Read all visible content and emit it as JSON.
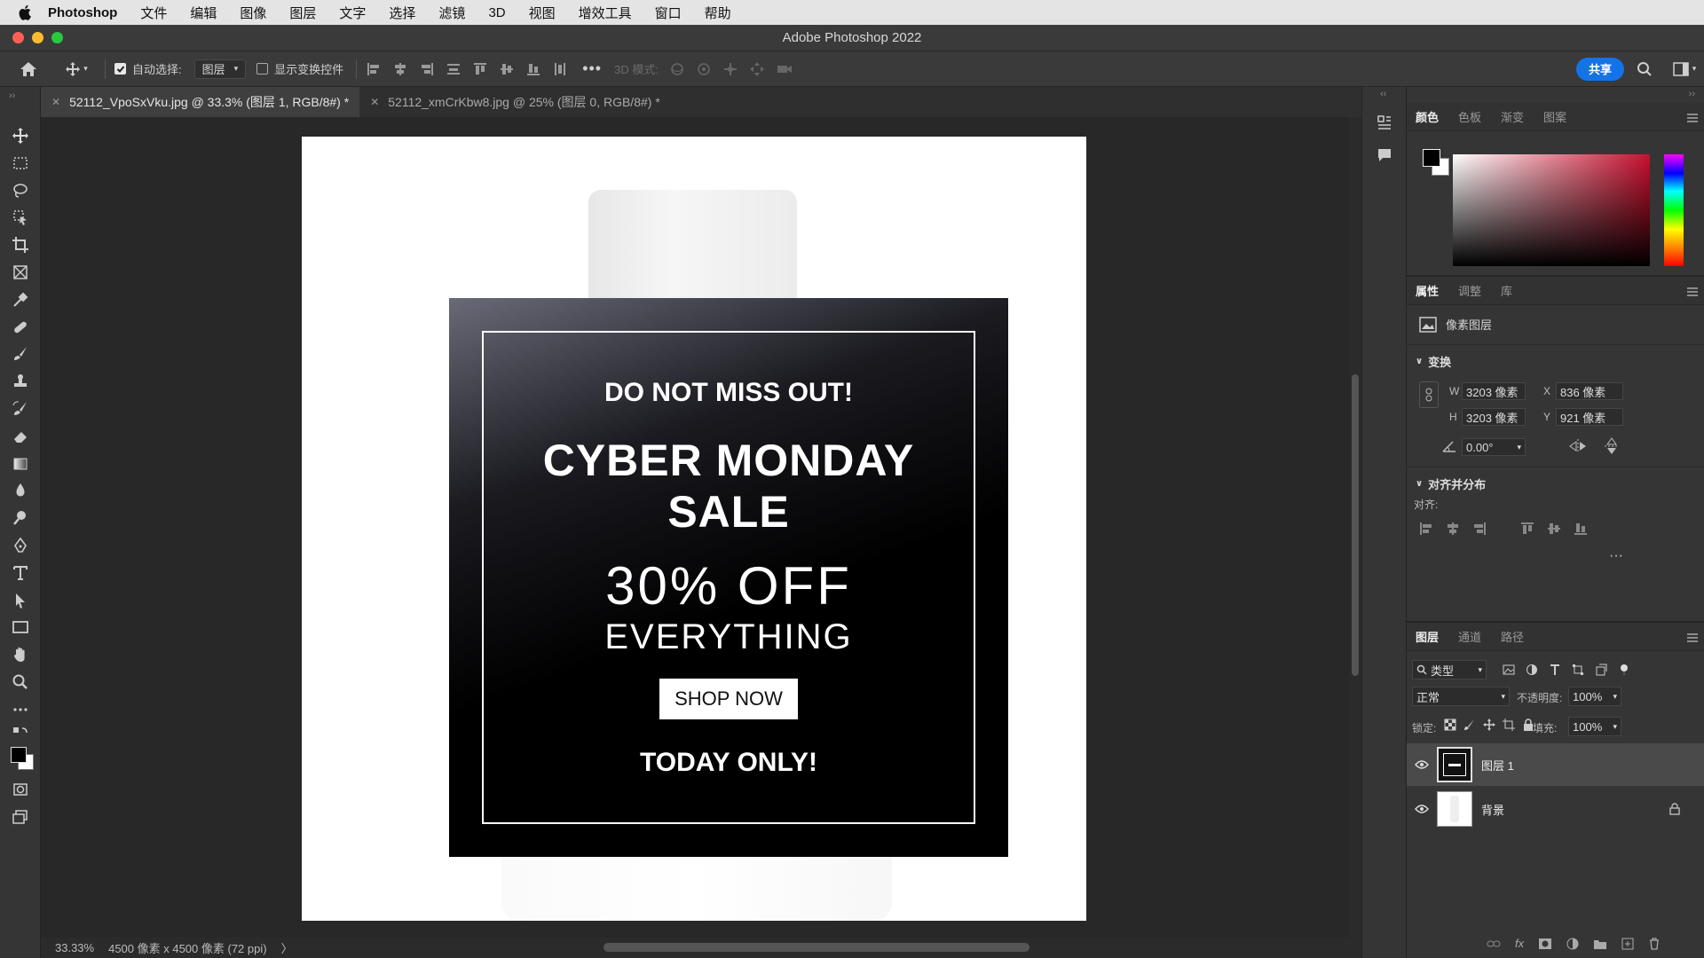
{
  "menubar": {
    "apple_icon": "apple-logo",
    "items": [
      "Photoshop",
      "文件",
      "编辑",
      "图像",
      "图层",
      "文字",
      "选择",
      "滤镜",
      "3D",
      "视图",
      "增效工具",
      "窗口",
      "帮助"
    ]
  },
  "window": {
    "title": "Adobe Photoshop 2022"
  },
  "options": {
    "auto_select_label": "自动选择:",
    "auto_select_value": "图层",
    "auto_select_checked": true,
    "show_transform_label": "显示变换控件",
    "show_transform_checked": false,
    "mode3d_label": "3D 模式:",
    "share_label": "共享"
  },
  "tabs": [
    {
      "label": "52112_VpoSxVku.jpg @ 33.3% (图层 1, RGB/8#) *",
      "active": true
    },
    {
      "label": "52112_xmCrKbw8.jpg @ 25% (图层 0, RGB/8#) *",
      "active": false
    }
  ],
  "banner": {
    "line1": "DO NOT MISS OUT!",
    "line2": "CYBER MONDAY",
    "line3": "SALE",
    "line4": "30% OFF",
    "line5": "EVERYTHING",
    "button": "SHOP NOW",
    "line6": "TODAY ONLY!"
  },
  "status": {
    "zoom": "33.33%",
    "doc_info": "4500 像素 x 4500 像素 (72 ppi)",
    "arrow": "〉"
  },
  "color_panel": {
    "tabs": [
      "颜色",
      "色板",
      "渐变",
      "图案"
    ],
    "foreground": "#000000",
    "background": "#ffffff",
    "hue_color": "#c8102e"
  },
  "properties_panel": {
    "tabs": [
      "属性",
      "调整",
      "库"
    ],
    "layer_type": "像素图层",
    "transform_title": "变换",
    "w_label": "W",
    "w_value": "3203 像素",
    "h_label": "H",
    "h_value": "3203 像素",
    "x_label": "X",
    "x_value": "836 像素",
    "y_label": "Y",
    "y_value": "921 像素",
    "angle_value": "0.00°",
    "align_title": "对齐并分布",
    "align_label": "对齐:",
    "more": "···"
  },
  "layers_panel": {
    "tabs": [
      "图层",
      "通道",
      "路径"
    ],
    "filter_label": "类型",
    "blend_mode": "正常",
    "opacity_label": "不透明度:",
    "opacity_value": "100%",
    "lock_label": "锁定:",
    "fill_label": "填充:",
    "fill_value": "100%",
    "layers": [
      {
        "name": "图层 1",
        "selected": true,
        "locked": false
      },
      {
        "name": "背景",
        "selected": false,
        "locked": true
      }
    ],
    "footer_fx": "fx"
  }
}
